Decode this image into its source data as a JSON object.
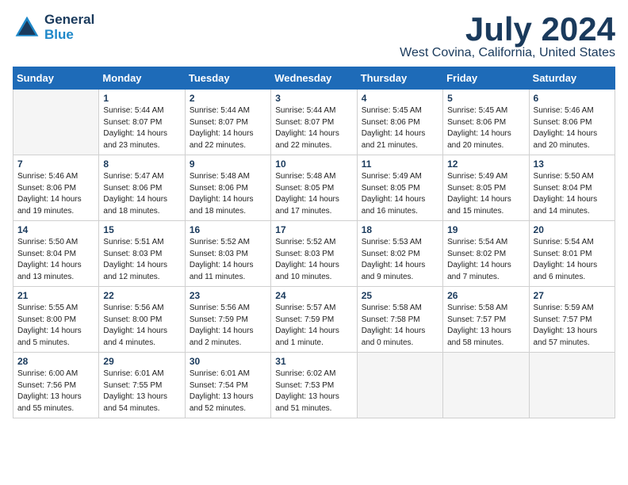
{
  "header": {
    "logo_line1": "General",
    "logo_line2": "Blue",
    "month": "July 2024",
    "location": "West Covina, California, United States"
  },
  "days_of_week": [
    "Sunday",
    "Monday",
    "Tuesday",
    "Wednesday",
    "Thursday",
    "Friday",
    "Saturday"
  ],
  "weeks": [
    [
      {
        "day": "",
        "info": ""
      },
      {
        "day": "1",
        "info": "Sunrise: 5:44 AM\nSunset: 8:07 PM\nDaylight: 14 hours\nand 23 minutes."
      },
      {
        "day": "2",
        "info": "Sunrise: 5:44 AM\nSunset: 8:07 PM\nDaylight: 14 hours\nand 22 minutes."
      },
      {
        "day": "3",
        "info": "Sunrise: 5:44 AM\nSunset: 8:07 PM\nDaylight: 14 hours\nand 22 minutes."
      },
      {
        "day": "4",
        "info": "Sunrise: 5:45 AM\nSunset: 8:06 PM\nDaylight: 14 hours\nand 21 minutes."
      },
      {
        "day": "5",
        "info": "Sunrise: 5:45 AM\nSunset: 8:06 PM\nDaylight: 14 hours\nand 20 minutes."
      },
      {
        "day": "6",
        "info": "Sunrise: 5:46 AM\nSunset: 8:06 PM\nDaylight: 14 hours\nand 20 minutes."
      }
    ],
    [
      {
        "day": "7",
        "info": "Sunrise: 5:46 AM\nSunset: 8:06 PM\nDaylight: 14 hours\nand 19 minutes."
      },
      {
        "day": "8",
        "info": "Sunrise: 5:47 AM\nSunset: 8:06 PM\nDaylight: 14 hours\nand 18 minutes."
      },
      {
        "day": "9",
        "info": "Sunrise: 5:48 AM\nSunset: 8:06 PM\nDaylight: 14 hours\nand 18 minutes."
      },
      {
        "day": "10",
        "info": "Sunrise: 5:48 AM\nSunset: 8:05 PM\nDaylight: 14 hours\nand 17 minutes."
      },
      {
        "day": "11",
        "info": "Sunrise: 5:49 AM\nSunset: 8:05 PM\nDaylight: 14 hours\nand 16 minutes."
      },
      {
        "day": "12",
        "info": "Sunrise: 5:49 AM\nSunset: 8:05 PM\nDaylight: 14 hours\nand 15 minutes."
      },
      {
        "day": "13",
        "info": "Sunrise: 5:50 AM\nSunset: 8:04 PM\nDaylight: 14 hours\nand 14 minutes."
      }
    ],
    [
      {
        "day": "14",
        "info": "Sunrise: 5:50 AM\nSunset: 8:04 PM\nDaylight: 14 hours\nand 13 minutes."
      },
      {
        "day": "15",
        "info": "Sunrise: 5:51 AM\nSunset: 8:03 PM\nDaylight: 14 hours\nand 12 minutes."
      },
      {
        "day": "16",
        "info": "Sunrise: 5:52 AM\nSunset: 8:03 PM\nDaylight: 14 hours\nand 11 minutes."
      },
      {
        "day": "17",
        "info": "Sunrise: 5:52 AM\nSunset: 8:03 PM\nDaylight: 14 hours\nand 10 minutes."
      },
      {
        "day": "18",
        "info": "Sunrise: 5:53 AM\nSunset: 8:02 PM\nDaylight: 14 hours\nand 9 minutes."
      },
      {
        "day": "19",
        "info": "Sunrise: 5:54 AM\nSunset: 8:02 PM\nDaylight: 14 hours\nand 7 minutes."
      },
      {
        "day": "20",
        "info": "Sunrise: 5:54 AM\nSunset: 8:01 PM\nDaylight: 14 hours\nand 6 minutes."
      }
    ],
    [
      {
        "day": "21",
        "info": "Sunrise: 5:55 AM\nSunset: 8:00 PM\nDaylight: 14 hours\nand 5 minutes."
      },
      {
        "day": "22",
        "info": "Sunrise: 5:56 AM\nSunset: 8:00 PM\nDaylight: 14 hours\nand 4 minutes."
      },
      {
        "day": "23",
        "info": "Sunrise: 5:56 AM\nSunset: 7:59 PM\nDaylight: 14 hours\nand 2 minutes."
      },
      {
        "day": "24",
        "info": "Sunrise: 5:57 AM\nSunset: 7:59 PM\nDaylight: 14 hours\nand 1 minute."
      },
      {
        "day": "25",
        "info": "Sunrise: 5:58 AM\nSunset: 7:58 PM\nDaylight: 14 hours\nand 0 minutes."
      },
      {
        "day": "26",
        "info": "Sunrise: 5:58 AM\nSunset: 7:57 PM\nDaylight: 13 hours\nand 58 minutes."
      },
      {
        "day": "27",
        "info": "Sunrise: 5:59 AM\nSunset: 7:57 PM\nDaylight: 13 hours\nand 57 minutes."
      }
    ],
    [
      {
        "day": "28",
        "info": "Sunrise: 6:00 AM\nSunset: 7:56 PM\nDaylight: 13 hours\nand 55 minutes."
      },
      {
        "day": "29",
        "info": "Sunrise: 6:01 AM\nSunset: 7:55 PM\nDaylight: 13 hours\nand 54 minutes."
      },
      {
        "day": "30",
        "info": "Sunrise: 6:01 AM\nSunset: 7:54 PM\nDaylight: 13 hours\nand 52 minutes."
      },
      {
        "day": "31",
        "info": "Sunrise: 6:02 AM\nSunset: 7:53 PM\nDaylight: 13 hours\nand 51 minutes."
      },
      {
        "day": "",
        "info": ""
      },
      {
        "day": "",
        "info": ""
      },
      {
        "day": "",
        "info": ""
      }
    ]
  ]
}
